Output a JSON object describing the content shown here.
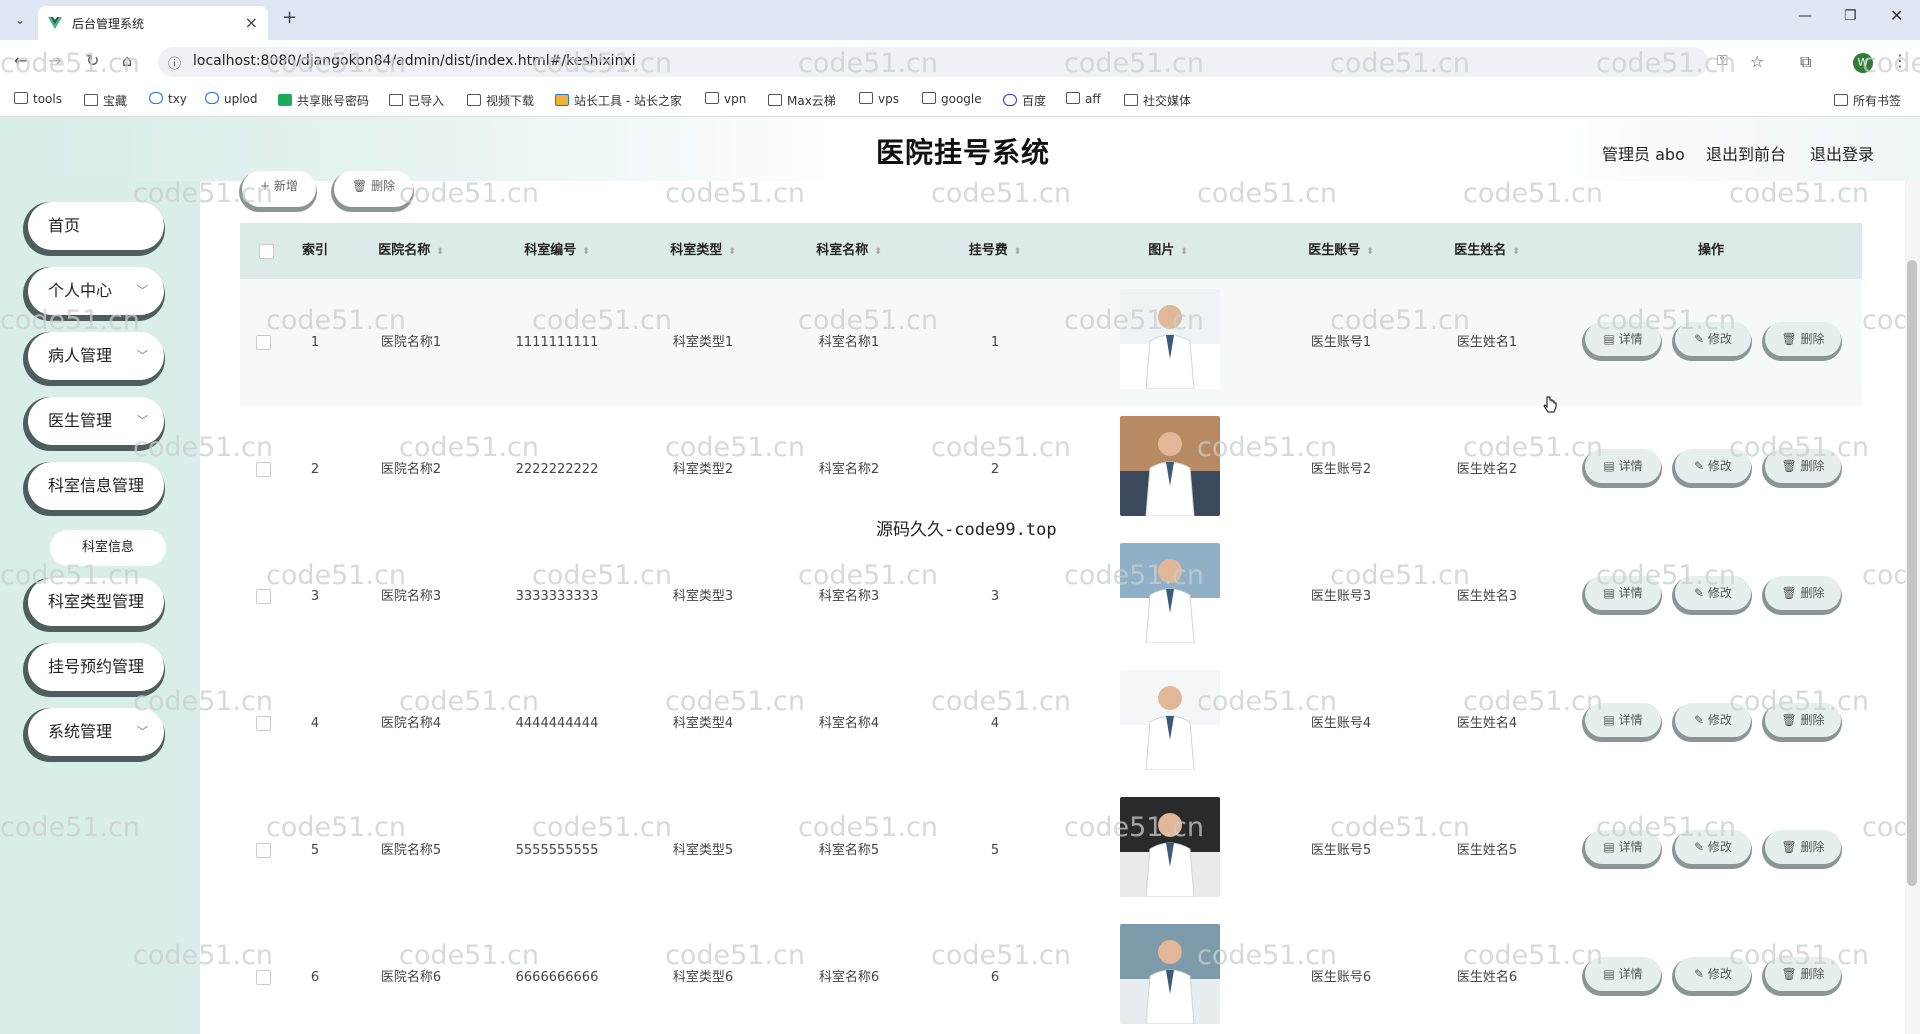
{
  "browser": {
    "tab_title": "后台管理系统",
    "url": "localhost:8080/djangokon84/admin/dist/index.html#/keshixinxi",
    "bookmarks": [
      "tools",
      "宝藏",
      "txy",
      "uplod",
      "共享账号密码",
      "已导入",
      "视频下载",
      "站长工具 - 站长之家",
      "vpn",
      "Max云梯",
      "vps",
      "google",
      "百度",
      "aff",
      "社交媒体"
    ],
    "all_bookmarks": "所有书签",
    "profile_initial": "W"
  },
  "header": {
    "title": "医院挂号系统",
    "admin": "管理员 abo",
    "to_front": "退出到前台",
    "logout": "退出登录"
  },
  "sidebar": {
    "items": [
      {
        "label": "首页",
        "has_children": false
      },
      {
        "label": "个人中心",
        "has_children": true
      },
      {
        "label": "病人管理",
        "has_children": true
      },
      {
        "label": "医生管理",
        "has_children": true
      },
      {
        "label": "科室信息管理",
        "has_children": false
      },
      {
        "label": "科室类型管理",
        "has_children": false
      },
      {
        "label": "挂号预约管理",
        "has_children": false
      },
      {
        "label": "系统管理",
        "has_children": true
      }
    ],
    "submenu": "科室信息"
  },
  "toolbar": {
    "add": "+ 新增",
    "delete": "删除"
  },
  "table": {
    "columns": [
      "索引",
      "医院名称",
      "科室编号",
      "科室类型",
      "科室名称",
      "挂号费",
      "图片",
      "医生账号",
      "医生姓名",
      "操作"
    ],
    "actions": {
      "detail": "详情",
      "edit": "修改",
      "delete": "删除"
    },
    "rows": [
      {
        "index": "1",
        "hospital": "医院名称1",
        "code": "1111111111",
        "type": "科室类型1",
        "name": "科室名称1",
        "fee": "1",
        "account": "医生账号1",
        "doctor": "医生姓名1"
      },
      {
        "index": "2",
        "hospital": "医院名称2",
        "code": "2222222222",
        "type": "科室类型2",
        "name": "科室名称2",
        "fee": "2",
        "account": "医生账号2",
        "doctor": "医生姓名2"
      },
      {
        "index": "3",
        "hospital": "医院名称3",
        "code": "3333333333",
        "type": "科室类型3",
        "name": "科室名称3",
        "fee": "3",
        "account": "医生账号3",
        "doctor": "医生姓名3"
      },
      {
        "index": "4",
        "hospital": "医院名称4",
        "code": "4444444444",
        "type": "科室类型4",
        "name": "科室名称4",
        "fee": "4",
        "account": "医生账号4",
        "doctor": "医生姓名4"
      },
      {
        "index": "5",
        "hospital": "医院名称5",
        "code": "5555555555",
        "type": "科室类型5",
        "name": "科室名称5",
        "fee": "5",
        "account": "医生账号5",
        "doctor": "医生姓名5"
      },
      {
        "index": "6",
        "hospital": "医院名称6",
        "code": "6666666666",
        "type": "科室类型6",
        "name": "科室名称6",
        "fee": "6",
        "account": "医生账号6",
        "doctor": "医生姓名6"
      }
    ]
  },
  "watermarks": {
    "repeat": "code51.cn",
    "center": "源码久久-code99.top"
  }
}
